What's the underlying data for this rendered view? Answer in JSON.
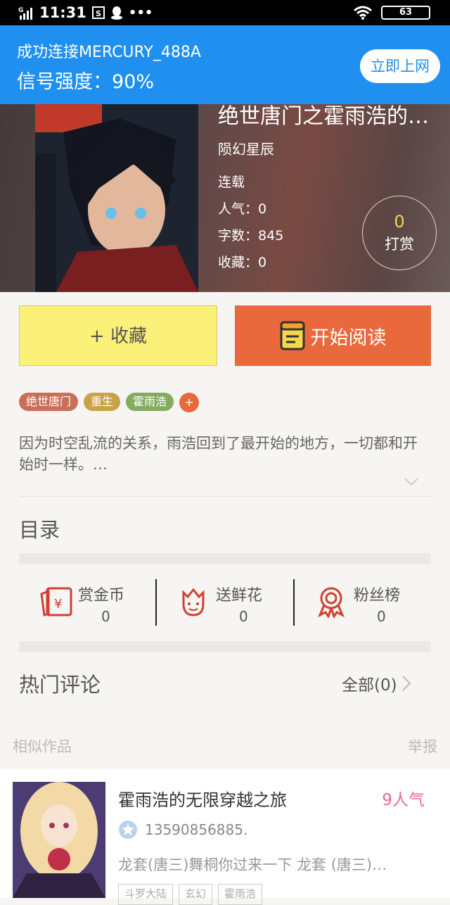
{
  "status_bar": {
    "time": "11:31",
    "battery": "63"
  },
  "banner": {
    "ssid_text": "成功连接MERCURY_488A",
    "signal_text": "信号强度：90%",
    "button": "立即上网"
  },
  "book": {
    "title": "绝世唐门之霍雨浩的…",
    "author": "陨幻星辰",
    "status": "连载",
    "stats": [
      {
        "label": "人气：",
        "value": "0"
      },
      {
        "label": "字数：",
        "value": "845"
      },
      {
        "label": "收藏：",
        "value": "0"
      }
    ],
    "tip_count": "0",
    "tip_label": "打赏"
  },
  "actions": {
    "favorite": "+ 收藏",
    "read": "开始阅读"
  },
  "tags": [
    {
      "text": "绝世唐门",
      "color": "#c96f55"
    },
    {
      "text": "重生",
      "color": "#c9a24a"
    },
    {
      "text": "霍雨浩",
      "color": "#83ac5d"
    }
  ],
  "tag_add": "+",
  "description": "因为时空乱流的关系，雨浩回到了最开始的地方，一切都和开始时一样。…",
  "catalog_title": "目录",
  "rewards": [
    {
      "label": "赏金币",
      "value": "0",
      "icon": "coin-envelope-icon"
    },
    {
      "label": "送鲜花",
      "value": "0",
      "icon": "flower-icon"
    },
    {
      "label": "粉丝榜",
      "value": "0",
      "icon": "medal-icon"
    }
  ],
  "comments": {
    "title": "热门评论",
    "all": "全部(0)"
  },
  "similar": {
    "title": "相似作品",
    "report": "举报",
    "item": {
      "name": "霍雨浩的无限穿越之旅",
      "popularity": "9人气",
      "user": "13590856885.",
      "intro": "龙套(唐三)舞桐你过来一下 龙套 (唐三)…",
      "tags": [
        "斗罗大陆",
        "玄幻",
        "霍雨浩"
      ]
    }
  },
  "accent_colors": {
    "blue": "#1f8ff0",
    "orange": "#e9693c",
    "yellow": "#fbf078",
    "red_icon": "#d0402f"
  }
}
